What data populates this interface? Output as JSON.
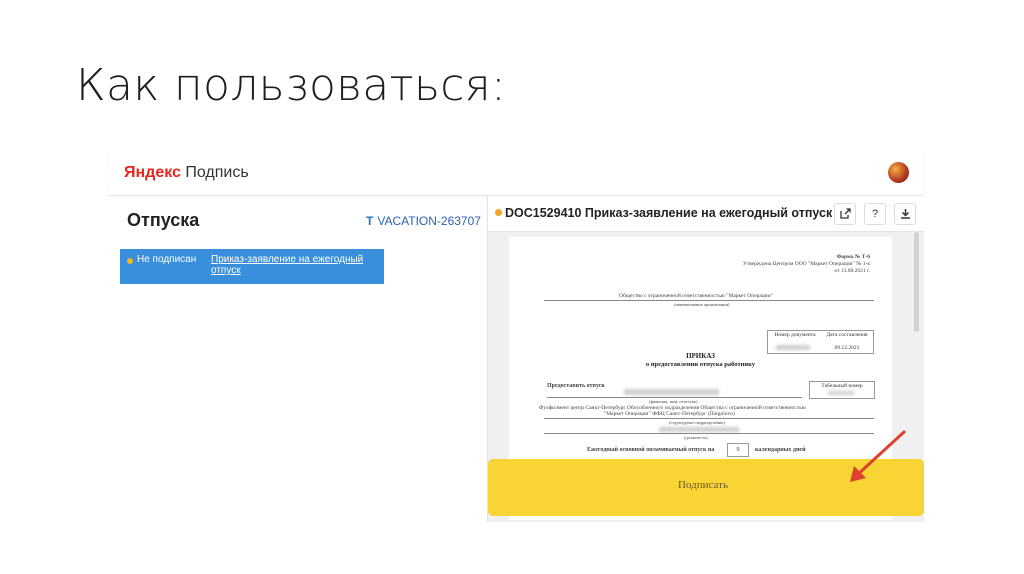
{
  "slide": {
    "title": "Как пользоваться:"
  },
  "app": {
    "logo_brand": "Яндекс",
    "logo_product": "Подпись"
  },
  "left": {
    "section_title": "Отпуска",
    "ticket": "VACATION-263707",
    "doc_status": "Не подписан",
    "doc_link": "Приказ-заявление на ежегодный отпуск"
  },
  "right": {
    "doc_title": "DOC1529410 Приказ-заявление на ежегодный отпуск",
    "buttons": {
      "open_icon": "external-link-icon",
      "help": "?",
      "download_icon": "download-icon"
    }
  },
  "document": {
    "form_no": "Форма № Т-6",
    "approved_line1": "Утверждена Центром ООО \"Маркет Операции\" № 1-к",
    "approved_line2": "от 13.08.2021 г.",
    "org_name": "Общество с ограниченной ответственностью \"Маркет Операции\"",
    "org_caption": "(наименование организации)",
    "doc_number_header": "Номер документа",
    "doc_date_header": "Дата составления",
    "doc_date": "09.12.2021",
    "prikaz": "ПРИКАЗ",
    "prikaz_sub": "о предоставлении отпуска работнику",
    "provide_label": "Предоставить отпуск",
    "tab_number_header": "Табельный номер",
    "fio_caption": "(фамилия, имя, отчество)",
    "unit_line1": "Фулфилмент центр Санкт-Петербург Обособленного подразделения Общества с ограниченной ответственностью",
    "unit_line2": "\"Маркет Операции\" ФФЦ Санкт-Петербург (Пargolovo)",
    "unit_caption": "(структурное подразделение)",
    "position_caption": "(должность)",
    "annual_leave": "Ежегодный основной оплачиваемый отпуск на",
    "days_value": "9",
    "days_unit": "календарных дней"
  },
  "sign": {
    "button": "Подписать"
  },
  "colors": {
    "accent_blue": "#3a8fdc",
    "sign_yellow": "#f8d434",
    "arrow_red": "#e0402e",
    "status_orange": "#f2a623"
  }
}
